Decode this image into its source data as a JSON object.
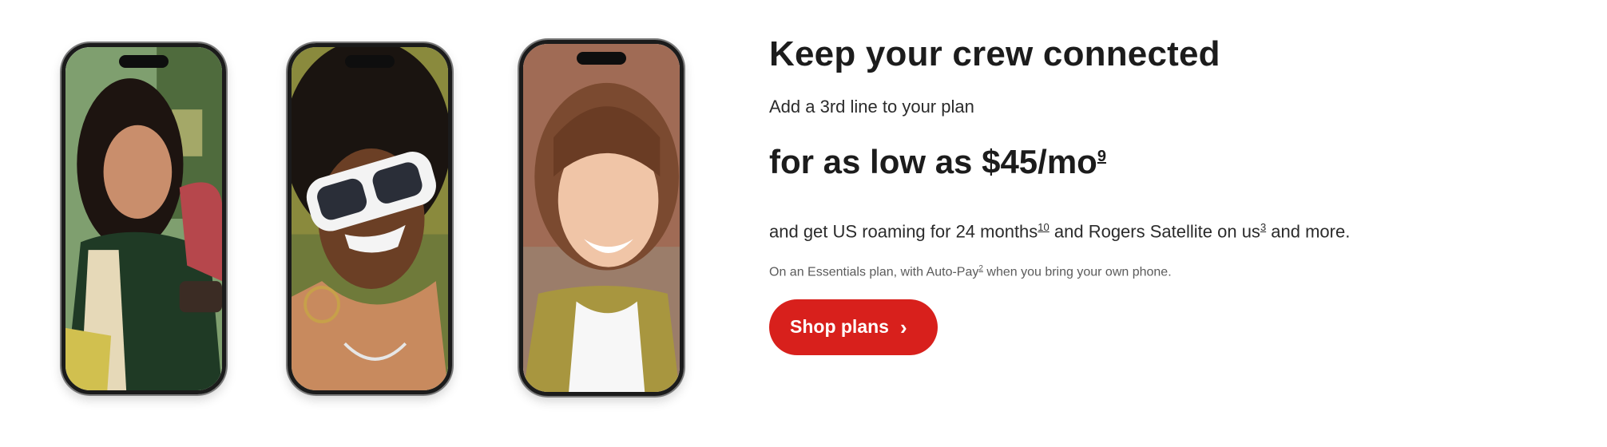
{
  "promo": {
    "headline": "Keep your crew connected",
    "subline": "Add a 3rd line to your plan",
    "price_text": "for as low as $45/mo",
    "price_footnote": "9",
    "details_1": "and get US roaming for 24 months",
    "details_fn_1": "10",
    "details_2": " and Rogers Satellite on us",
    "details_fn_2": "3",
    "details_3": " and more.",
    "legal_1": "On an Essentials plan, with Auto-Pay",
    "legal_fn": "2",
    "legal_2": " when you bring your own phone.",
    "cta_label": "Shop plans",
    "cta_icon": "chevron-right-icon"
  },
  "colors": {
    "accent": "#d8201c",
    "text": "#1c1c1c",
    "muted": "#5b5b5b"
  }
}
